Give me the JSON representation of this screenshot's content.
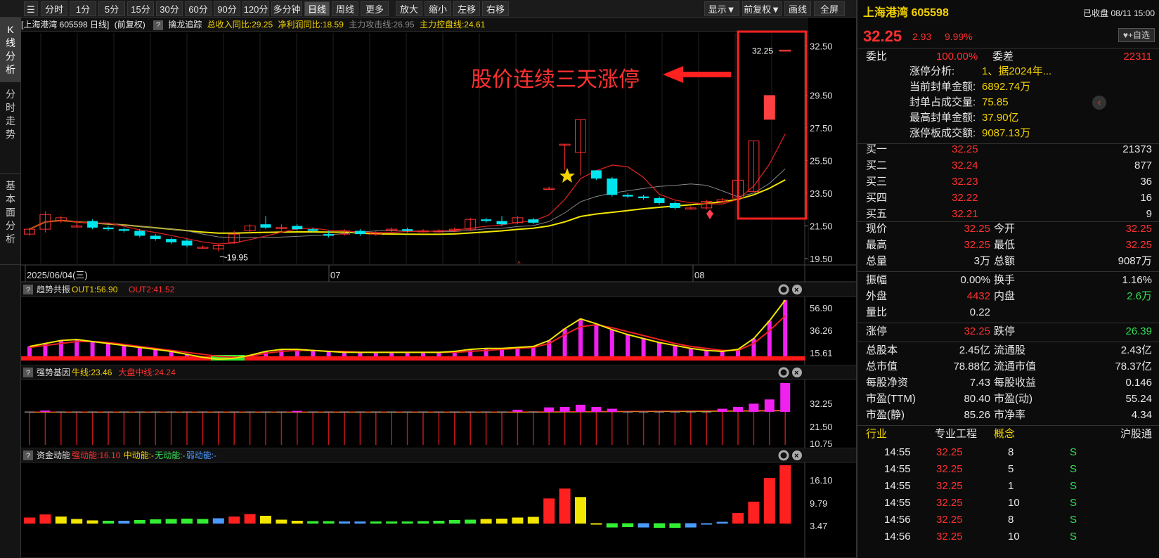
{
  "toolbar": {
    "period_tabs": [
      "分时",
      "1分",
      "5分",
      "15分",
      "30分",
      "60分",
      "90分",
      "120分",
      "多分钟",
      "日线",
      "周线",
      "更多▼"
    ],
    "active_tab": "日线",
    "actions": [
      "放大",
      "缩小",
      "左移",
      "右移"
    ],
    "right_buttons": [
      "显示▼",
      "前复权▼",
      "画线",
      "全屏"
    ]
  },
  "side_tabs": [
    "K线分析",
    "分时走势",
    "基本面分析"
  ],
  "chart_header": {
    "title": "[上海港湾 605598 日线]",
    "adjust": "(前复权)",
    "indicator": "擒龙追踪",
    "revenue_label": "总收入同比:29.25",
    "profit_label": "净利润同比:18.59",
    "attack_label": "主力攻击线:26.95",
    "control_label": "主力控盘线:24.61"
  },
  "chart_data": {
    "type": "candlestick",
    "y_ticks": [
      32.5,
      29.5,
      27.5,
      25.5,
      23.5,
      21.5,
      19.5
    ],
    "x_labels": [
      "2025/06/04(三)",
      "07",
      "08"
    ],
    "low_label": "19.95",
    "high_label": "32.25",
    "annotation": "股价连续三天涨停",
    "candles": [
      [
        21.0,
        21.3,
        20.9,
        21.4
      ],
      [
        21.3,
        22.2,
        21.1,
        22.4
      ],
      [
        21.8,
        22.0,
        21.7,
        22.1
      ],
      [
        21.5,
        21.5,
        21.4,
        21.8
      ],
      [
        21.8,
        21.4,
        21.3,
        21.9
      ],
      [
        21.4,
        21.3,
        21.2,
        21.5
      ],
      [
        21.3,
        21.2,
        21.1,
        21.4
      ],
      [
        21.2,
        20.9,
        20.8,
        21.3
      ],
      [
        20.9,
        20.7,
        20.6,
        21.0
      ],
      [
        20.7,
        20.5,
        20.4,
        20.8
      ],
      [
        20.6,
        20.3,
        20.2,
        20.7
      ],
      [
        20.2,
        20.2,
        20.1,
        20.3
      ],
      [
        20.1,
        20.3,
        19.95,
        20.4
      ],
      [
        20.5,
        21.0,
        20.4,
        21.2
      ],
      [
        21.2,
        21.5,
        21.0,
        21.6
      ],
      [
        21.6,
        21.4,
        21.3,
        22.1
      ],
      [
        21.4,
        21.4,
        21.2,
        21.6
      ],
      [
        21.5,
        21.3,
        21.2,
        21.6
      ],
      [
        21.3,
        21.2,
        21.1,
        21.4
      ],
      [
        21.0,
        20.9,
        20.8,
        21.2
      ],
      [
        21.0,
        21.2,
        20.9,
        21.3
      ],
      [
        21.2,
        21.0,
        20.9,
        21.3
      ],
      [
        21.0,
        21.1,
        20.9,
        21.2
      ],
      [
        21.2,
        21.3,
        21.1,
        21.4
      ],
      [
        21.3,
        21.2,
        21.1,
        21.4
      ],
      [
        21.2,
        21.2,
        21.1,
        21.3
      ],
      [
        21.2,
        21.2,
        21.1,
        21.3
      ],
      [
        21.2,
        21.3,
        21.1,
        21.4
      ],
      [
        21.3,
        21.9,
        21.2,
        22.0
      ],
      [
        21.9,
        21.8,
        21.7,
        22.0
      ],
      [
        21.8,
        21.6,
        21.5,
        22.1
      ],
      [
        21.7,
        22.0,
        21.6,
        22.1
      ],
      [
        21.9,
        21.7,
        21.6,
        22.0
      ],
      [
        23.8,
        23.8,
        23.7,
        23.9
      ],
      [
        26.5,
        26.5,
        24.9,
        26.5
      ],
      [
        26.0,
        28.0,
        24.6,
        28.0
      ],
      [
        24.9,
        24.4,
        24.3,
        24.9
      ],
      [
        24.4,
        23.4,
        23.3,
        24.5
      ],
      [
        23.4,
        23.3,
        23.2,
        23.5
      ],
      [
        23.3,
        23.2,
        23.1,
        23.4
      ],
      [
        23.2,
        22.9,
        22.8,
        23.3
      ],
      [
        22.9,
        22.6,
        22.5,
        23.0
      ],
      [
        22.6,
        22.6,
        22.5,
        22.7
      ],
      [
        22.6,
        23.0,
        22.5,
        23.1
      ],
      [
        23.0,
        23.1,
        22.9,
        23.2
      ],
      [
        23.2,
        24.3,
        23.0,
        25.1
      ],
      [
        23.6,
        26.7,
        23.6,
        26.7
      ],
      [
        29.3,
        29.3,
        29.3,
        29.3
      ],
      [
        32.25,
        32.25,
        32.25,
        32.25
      ]
    ]
  },
  "panels": [
    {
      "title": "趋势共振",
      "labels": [
        {
          "text": "OUT1:56.90",
          "color": "#f2d200"
        },
        {
          "text": "OUT2:41.52",
          "color": "#ff3030"
        }
      ],
      "ticks": [
        "56.90",
        "36.26",
        "15.61"
      ]
    },
    {
      "title": "强势基因",
      "labels": [
        {
          "text": "牛线:23.46",
          "color": "#f2d200"
        },
        {
          "text": "大盘中线:24.24",
          "color": "#ff3030"
        }
      ],
      "ticks": [
        "32.25",
        "21.50",
        "10.75"
      ]
    },
    {
      "title": "资金动能",
      "labels": [
        {
          "text": "强动能:16.10",
          "color": "#ff3030"
        },
        {
          "text": "中动能:-",
          "color": "#f2d200"
        },
        {
          "text": "无动能:-",
          "color": "#33dd55"
        },
        {
          "text": "弱动能:-",
          "color": "#4b9bff"
        }
      ],
      "ticks": [
        "16.10",
        "9.79",
        "3.47"
      ]
    }
  ],
  "side": {
    "name": "上海港湾 605598",
    "status": "已收盘 08/11 15:00",
    "price": "32.25",
    "change": "2.93",
    "pct": "9.99%",
    "watch_btn": "♥+自选",
    "weibi_label": "委比",
    "weibi": "100.00%",
    "weicha_label": "委差",
    "weicha": "22311",
    "limit_info": [
      {
        "label": "涨停分析:",
        "value": "1、据2024年..."
      },
      {
        "label": "当前封单金额:",
        "value": "6892.74万"
      },
      {
        "label": "封单占成交量:",
        "value": "75.85"
      },
      {
        "label": "最高封单金额:",
        "value": "37.90亿"
      },
      {
        "label": "涨停板成交额:",
        "value": "9087.13万"
      }
    ],
    "bids": [
      {
        "label": "买一",
        "price": "32.25",
        "vol": "21373"
      },
      {
        "label": "买二",
        "price": "32.24",
        "vol": "877"
      },
      {
        "label": "买三",
        "price": "32.23",
        "vol": "36"
      },
      {
        "label": "买四",
        "price": "32.22",
        "vol": "16"
      },
      {
        "label": "买五",
        "price": "32.21",
        "vol": "9"
      }
    ],
    "stats1": [
      {
        "l1": "现价",
        "v1": "32.25",
        "c1": "red",
        "l2": "今开",
        "v2": "32.25",
        "c2": "red"
      },
      {
        "l1": "最高",
        "v1": "32.25",
        "c1": "red",
        "l2": "最低",
        "v2": "32.25",
        "c2": "red"
      },
      {
        "l1": "总量",
        "v1": "3万",
        "c1": "white",
        "l2": "总额",
        "v2": "9087万",
        "c2": "white"
      }
    ],
    "stats2": [
      {
        "l1": "振幅",
        "v1": "0.00%",
        "c1": "white",
        "l2": "换手",
        "v2": "1.16%",
        "c2": "white"
      },
      {
        "l1": "外盘",
        "v1": "4432",
        "c1": "red",
        "l2": "内盘",
        "v2": "2.6万",
        "c2": "green"
      },
      {
        "l1": "量比",
        "v1": "0.22",
        "c1": "white",
        "l2": "",
        "v2": "",
        "c2": "white"
      }
    ],
    "stats3": [
      {
        "l1": "涨停",
        "v1": "32.25",
        "c1": "red",
        "l2": "跌停",
        "v2": "26.39",
        "c2": "green"
      }
    ],
    "stats4": [
      {
        "l1": "总股本",
        "v1": "2.45亿",
        "c1": "white",
        "l2": "流通股",
        "v2": "2.43亿",
        "c2": "white"
      },
      {
        "l1": "总市值",
        "v1": "78.88亿",
        "c1": "white",
        "l2": "流通市值",
        "v2": "78.37亿",
        "c2": "white"
      },
      {
        "l1": "每股净资",
        "v1": "7.43",
        "c1": "white",
        "l2": "每股收益",
        "v2": "0.146",
        "c2": "white"
      },
      {
        "l1": "市盈(TTM)",
        "v1": "80.40",
        "c1": "white",
        "l2": "市盈(动)",
        "v2": "55.24",
        "c2": "white"
      },
      {
        "l1": "市盈(静)",
        "v1": "85.26",
        "c1": "white",
        "l2": "市净率",
        "v2": "4.34",
        "c2": "white"
      }
    ],
    "industry_row": {
      "l1": "行业",
      "v1": "专业工程",
      "l2": "概念",
      "v2": "沪股通"
    },
    "ticks": [
      {
        "time": "14:55",
        "price": "32.25",
        "vol": "8",
        "dir": "S"
      },
      {
        "time": "14:55",
        "price": "32.25",
        "vol": "5",
        "dir": "S"
      },
      {
        "time": "14:55",
        "price": "32.25",
        "vol": "1",
        "dir": "S"
      },
      {
        "time": "14:55",
        "price": "32.25",
        "vol": "10",
        "dir": "S"
      },
      {
        "time": "14:56",
        "price": "32.25",
        "vol": "8",
        "dir": "S"
      },
      {
        "time": "14:56",
        "price": "32.25",
        "vol": "10",
        "dir": "S"
      }
    ]
  }
}
